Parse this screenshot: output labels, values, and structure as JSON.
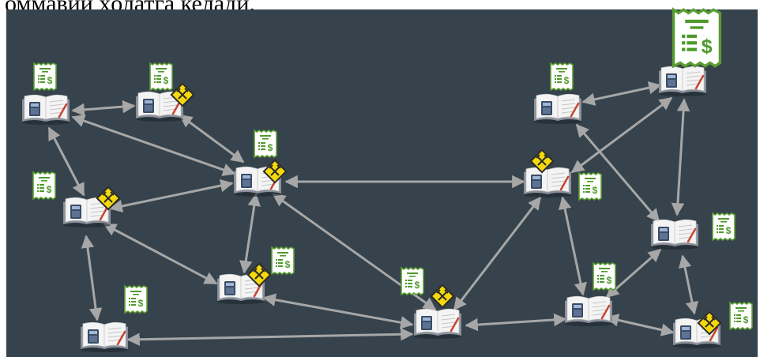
{
  "heading": "оммавий ҳолатга келади.",
  "colors": {
    "background": "#36434c",
    "edge": "#a7a7a7",
    "receipt_fill": "#ffffff",
    "receipt_border": "#5a9e32",
    "receipt_icon": "#4f9a2c",
    "sign_fill": "#f5d90c",
    "sign_border": "#2b2b2b",
    "calculator": "#3a4c66",
    "book_pages": "#f4f4f4",
    "book_cover": "#8a8f99"
  },
  "icons": {
    "node": "ledger-book-calculator-icon",
    "receipt": "receipt-dollar-icon",
    "sign": "road-work-sign-icon"
  }
}
